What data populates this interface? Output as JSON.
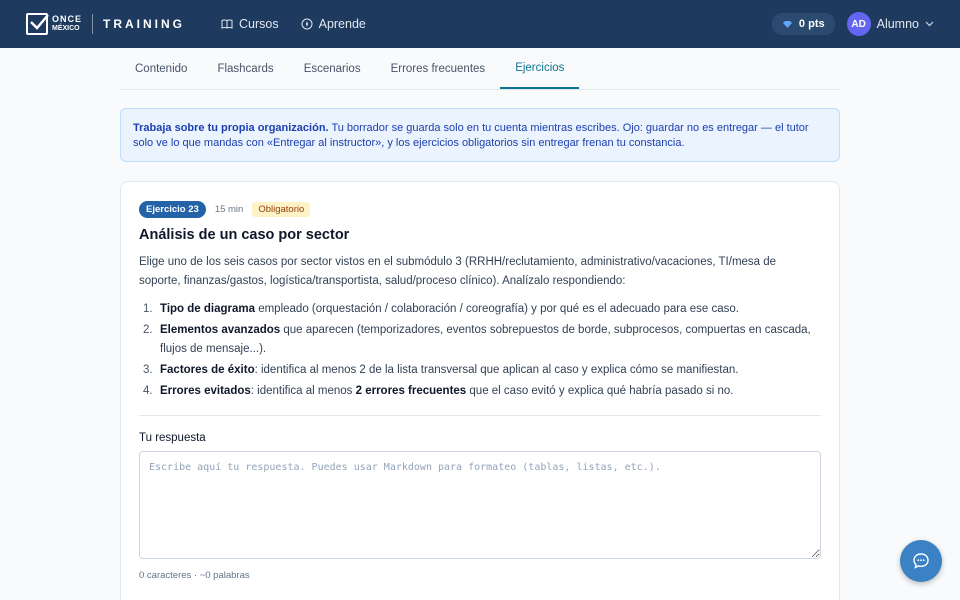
{
  "header": {
    "logo_top": "ONCE",
    "logo_bottom": "MÉXICO",
    "logo_training": "TRAINING",
    "nav": [
      {
        "label": "Cursos",
        "icon": "book-icon"
      },
      {
        "label": "Aprende",
        "icon": "compass-icon"
      }
    ],
    "points": "0 pts",
    "user": {
      "initials": "AD",
      "name": "Alumno"
    }
  },
  "tabs": [
    {
      "label": "Contenido",
      "active": false
    },
    {
      "label": "Flashcards",
      "active": false
    },
    {
      "label": "Escenarios",
      "active": false
    },
    {
      "label": "Errores frecuentes",
      "active": false
    },
    {
      "label": "Ejercicios",
      "active": true
    }
  ],
  "notice": {
    "strong": "Trabaja sobre tu propia organización.",
    "text": " Tu borrador se guarda solo en tu cuenta mientras escribes. Ojo: guardar no es entregar — el tutor solo ve lo que mandas con «Entregar al instructor», y los ejercicios obligatorios sin entregar frenan tu constancia."
  },
  "exercise": {
    "badge": "Ejercicio 23",
    "duration": "15 min",
    "required": "Obligatorio",
    "title": "Análisis de un caso por sector",
    "description": "Elige uno de los seis casos por sector vistos en el submódulo 3 (RRHH/reclutamiento, administrativo/vacaciones, TI/mesa de soporte, finanzas/gastos, logística/transportista, salud/proceso clínico). Analízalo respondiendo:",
    "items": [
      {
        "num": "1.",
        "bold": "Tipo de diagrama",
        "pre": "",
        "rest": " empleado (orquestación / colaboración / coreografía) y por qué es el adecuado para ese caso.",
        "bold2": "",
        "rest2": ""
      },
      {
        "num": "2.",
        "bold": "Elementos avanzados",
        "pre": "",
        "rest": " que aparecen (temporizadores, eventos sobrepuestos de borde, subprocesos, compuertas en cascada, flujos de mensaje...).",
        "bold2": "",
        "rest2": ""
      },
      {
        "num": "3.",
        "bold": "Factores de éxito",
        "pre": "",
        "rest": ": identifica al menos 2 de la lista transversal que aplican al caso y explica cómo se manifiestan.",
        "bold2": "",
        "rest2": ""
      },
      {
        "num": "4.",
        "bold": "Errores evitados",
        "pre": "",
        "rest": ": identifica al menos ",
        "bold2": "2 errores frecuentes",
        "rest2": " que el caso evitó y explica qué habría pasado si no."
      }
    ],
    "response_label": "Tu respuesta",
    "response_value": "",
    "response_placeholder": "Escribe aquí tu respuesta. Puedes usar Markdown para formateo (tablas, listas, etc.).",
    "counter": "0 caracteres · ~0 palabras"
  }
}
